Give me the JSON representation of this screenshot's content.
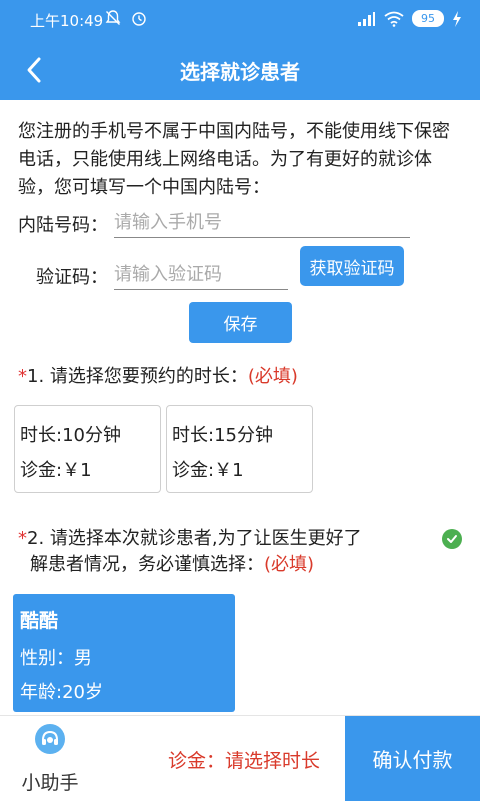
{
  "status_bar": {
    "time": "上午10:49",
    "battery": "95",
    "icons": [
      "mute-icon",
      "alarm-icon",
      "signal-icon",
      "wifi-icon",
      "battery-icon",
      "charging-icon"
    ]
  },
  "header": {
    "title": "选择就诊患者",
    "back_icon": "chevron-left-icon"
  },
  "intro_text": "您注册的手机号不属于中国内陆号，不能使用线下保密电话，只能使用线上网络电话。为了有更好的就诊体验，您可填写一个中国内陆号：",
  "phone": {
    "label": "内陆号码：",
    "value": "",
    "placeholder": "请输入手机号"
  },
  "code": {
    "label": "验证码：",
    "value": "",
    "placeholder": "请输入验证码",
    "button": "获取验证码"
  },
  "save_button": "保存",
  "section1": {
    "star": "*",
    "text": "1. 请选择您要预约的时长：",
    "required": "(必填)",
    "options": [
      {
        "duration": "时长:10分钟",
        "fee": "诊金:￥1"
      },
      {
        "duration": "时长:15分钟",
        "fee": "诊金:￥1"
      }
    ]
  },
  "section2": {
    "star": "*",
    "text_line1": "2. 请选择本次就诊患者,为了让医生更好了",
    "text_line2": "解患者情况，务必谨慎选择：",
    "required": "(必填)",
    "check_icon": "check-circle-icon"
  },
  "patient": {
    "name": "酷酷",
    "gender": "性别：男",
    "age": "年龄:20岁"
  },
  "bottom": {
    "assistant_label": "小助手",
    "fee_status": "诊金：请选择时长",
    "confirm_button": "确认付款"
  },
  "colors": {
    "primary": "#3a97ec",
    "required": "#d93a2b",
    "check": "#4caf50"
  }
}
